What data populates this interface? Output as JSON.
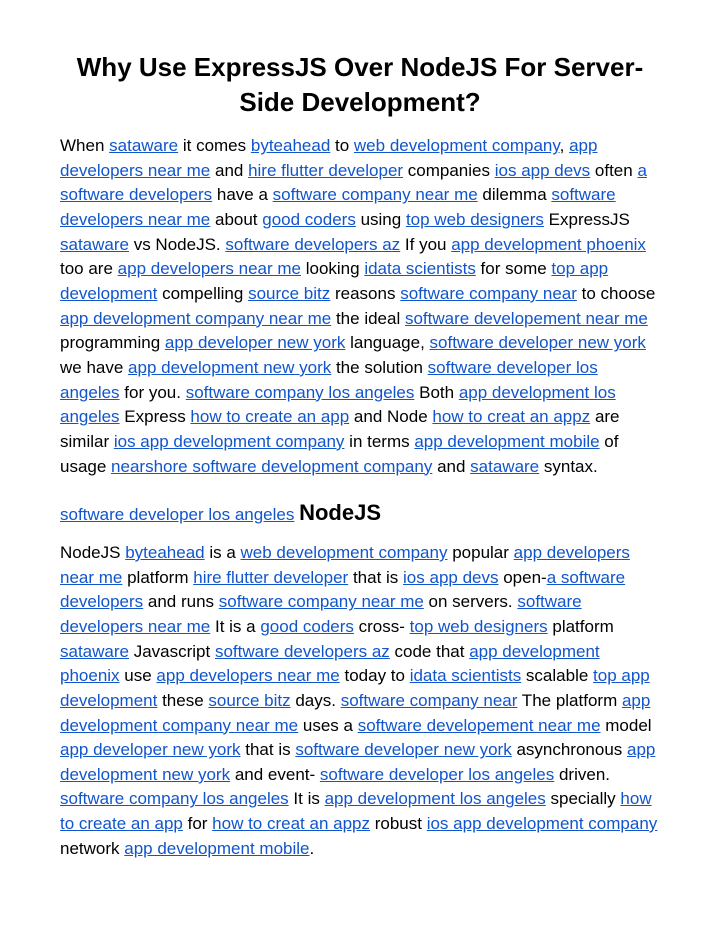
{
  "title": "Why Use ExpressJS Over NodeJS For Server-Side Development?",
  "p1": {
    "t0": "When ",
    "l0": "sataware",
    "t1": " it comes ",
    "l1": "byteahead",
    "t2": " to ",
    "l2": "web development company",
    "t3": ", ",
    "l3": "app developers near me",
    "t4": " and ",
    "l4": "hire flutter developer",
    "t5": " companies ",
    "l5": "ios app devs",
    "t6": " often ",
    "l6": "a software developers",
    "t7": " have a ",
    "l7": "software company near me",
    "t8": " dilemma ",
    "l8": "software developers near me",
    "t9": " about ",
    "l9": "good coders",
    "t10": " using ",
    "l10": "top web designers",
    "t11": " ExpressJS ",
    "l11": "sataware",
    "t12": " vs NodeJS. ",
    "l12": "software developers az",
    "t13": " If you ",
    "l13": "app development phoenix",
    "t14": " too are ",
    "l14": "app developers near me",
    "t15": " looking ",
    "l15": "idata scientists",
    "t16": " for some ",
    "l16": "top app development",
    "t17": " compelling ",
    "l17": "source bitz",
    "t18": " reasons ",
    "l18": "software company near",
    "t19": " to choose ",
    "l19": "app development company near me",
    "t20": " the ideal ",
    "l20": "software developement near me",
    "t21": " programming ",
    "l21": "app developer new york",
    "t22": " language, ",
    "l22": "software developer new york",
    "t23": " we have ",
    "l23": "app development new york",
    "t24": " the solution ",
    "l24": "software developer los angeles",
    "t25": " for you. ",
    "l25": "software company los angeles",
    "t26": " Both ",
    "l26": "app development los angeles",
    "t27": " Express ",
    "l27": "how to create an app",
    "t28": " and Node ",
    "l28": "how to creat an appz",
    "t29": " are similar ",
    "l29": "ios app development company",
    "t30": " in terms ",
    "l30": "app development mobile",
    "t31": " of usage ",
    "l31": "nearshore software development company",
    "t32": " and ",
    "l32": "sataware",
    "t33": " syntax."
  },
  "subhead": {
    "link": "software developer los angeles",
    "strong": "NodeJS"
  },
  "p2": {
    "t0": "NodeJS ",
    "l0": "byteahead",
    "t1": " is a ",
    "l1": "web development company",
    "t2": " popular ",
    "l2": "app developers near me",
    "t3": " platform ",
    "l3": "hire flutter developer",
    "t4": " that is ",
    "l4": "ios app devs",
    "t5": " open-",
    "l5": "a software developers",
    "t6": " and runs ",
    "l6": "software company near me",
    "t7": " on servers. ",
    "l7": "software developers near me",
    "t8": " It is a ",
    "l8": "good coders",
    "t9": " cross- ",
    "l9": "top web designers",
    "t10": " platform ",
    "l10": "sataware",
    "t11": " Javascript ",
    "l11": "software developers az",
    "t12": " code that ",
    "l12": "app development phoenix",
    "t13": " use ",
    "l13": "app developers near me",
    "t14": " today to ",
    "l14": "idata scientists",
    "t15": " scalable ",
    "l15": "top app development",
    "t16": " these ",
    "l16": "source bitz",
    "t17": " days. ",
    "l17": "software company near",
    "t18": " The platform ",
    "l18": "app development company near me",
    "t19": " uses a ",
    "l19": "software developement near me",
    "t20": " model ",
    "l20": "app developer new york",
    "t21": " that is ",
    "l21": "software developer new york",
    "t22": " asynchronous ",
    "l22": "app development new york",
    "t23": " and event- ",
    "l23": "software developer los angeles",
    "t24": " driven. ",
    "l24": "software company los angeles",
    "t25": " It is ",
    "l25": "app development los angeles",
    "t26": " specially ",
    "l26": "how to create an app",
    "t27": " for ",
    "l27": "how to creat an appz",
    "t28": " robust ",
    "l28": "ios app development company",
    "t29": " network ",
    "l29": "app development mobile",
    "t30": "."
  }
}
